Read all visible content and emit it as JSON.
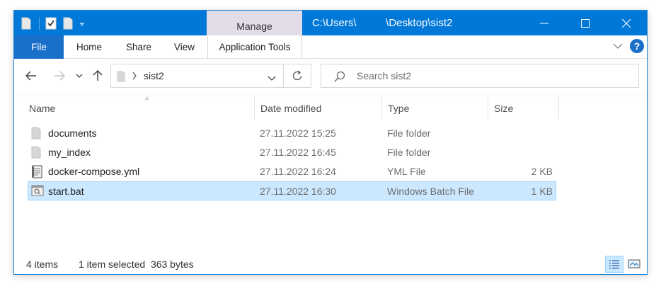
{
  "colors": {
    "titlebar": "#0078d7",
    "file_tab": "#1a6fc9",
    "manage_tab": "#e3dce9",
    "selection": "#cce8ff",
    "selection_border": "#99d1ff"
  },
  "titlebar": {
    "manage_label": "Manage",
    "title": "C:\\Users\\          \\Desktop\\sist2",
    "qat_icons": [
      "folder-icon",
      "properties-check-icon",
      "new-folder-icon",
      "qat-dropdown-icon"
    ],
    "controls": [
      "minimize-icon",
      "maximize-icon",
      "close-icon"
    ]
  },
  "ribbon": {
    "file": "File",
    "home": "Home",
    "share": "Share",
    "view": "View",
    "application_tools": "Application Tools",
    "help": "?"
  },
  "navigation": {
    "back_icon": "back-arrow-icon",
    "forward_icon": "forward-arrow-icon",
    "recent_icon": "recent-locations-chevron-icon",
    "up_icon": "up-arrow-icon",
    "address_path": "sist2",
    "search_placeholder": "Search sist2"
  },
  "columns": {
    "name": "Name",
    "date_modified": "Date modified",
    "type": "Type",
    "size": "Size",
    "sort_indicator": "^"
  },
  "files": [
    {
      "name": "documents",
      "date": "27.11.2022 15:25",
      "type": "File folder",
      "size": "",
      "icon": "folder-icon",
      "selected": false
    },
    {
      "name": "my_index",
      "date": "27.11.2022 16:45",
      "type": "File folder",
      "size": "",
      "icon": "folder-icon",
      "selected": false
    },
    {
      "name": "docker-compose.yml",
      "date": "27.11.2022 16:24",
      "type": "YML File",
      "size": "2 KB",
      "icon": "text-file-icon",
      "selected": false
    },
    {
      "name": "start.bat",
      "date": "27.11.2022 16:30",
      "type": "Windows Batch File",
      "size": "1 KB",
      "icon": "batch-file-icon",
      "selected": true
    }
  ],
  "status": {
    "item_count": "4 items",
    "selection": "1 item selected  363 bytes",
    "view_buttons": [
      "details-view-icon",
      "large-icons-view-icon"
    ]
  }
}
